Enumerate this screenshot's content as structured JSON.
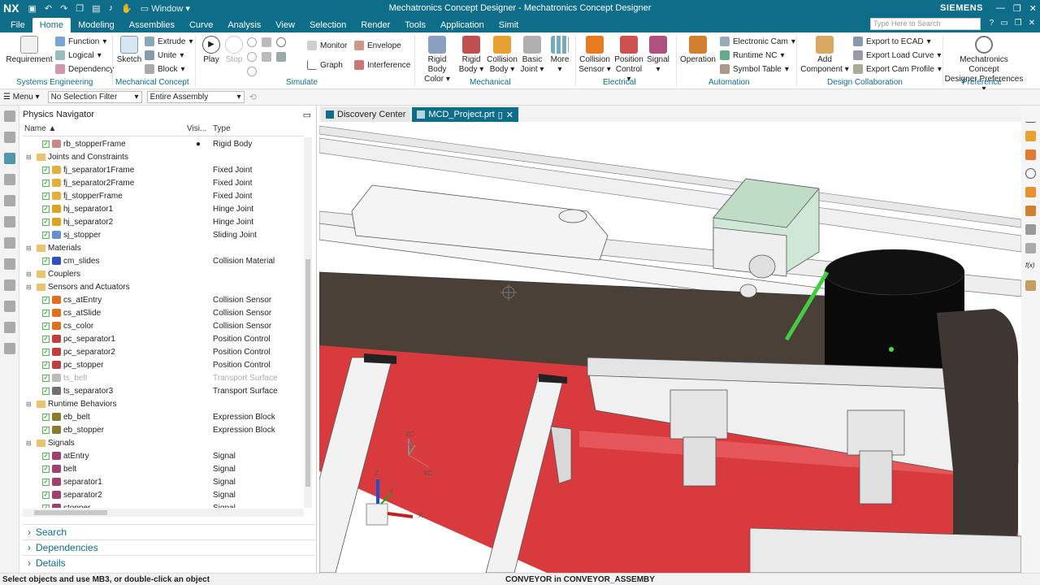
{
  "titlebar": {
    "logo": "NX",
    "window_menu": "Window",
    "title": "Mechatronics Concept Designer - Mechatronics Concept Designer",
    "brand": "SIEMENS"
  },
  "menubar": {
    "tabs": [
      "File",
      "Home",
      "Modeling",
      "Assemblies",
      "Curve",
      "Analysis",
      "View",
      "Selection",
      "Render",
      "Tools",
      "Application",
      "Simit"
    ],
    "active": "Home",
    "search_placeholder": "Type Here to Search"
  },
  "ribbon": {
    "requirement": "Requirement",
    "function": "Function",
    "logical": "Logical",
    "dependency": "Dependency",
    "sketch": "Sketch",
    "extrude": "Extrude",
    "unite": "Unite",
    "block": "Block",
    "play": "Play",
    "stop": "Stop",
    "monitor": "Monitor",
    "graph": "Graph",
    "envelope": "Envelope",
    "interference": "Interference",
    "rigid_body_color": [
      "Rigid Body",
      "Color"
    ],
    "rigid_body": [
      "Rigid",
      "Body"
    ],
    "collision_body": [
      "Collision",
      "Body"
    ],
    "basic_joint": [
      "Basic",
      "Joint"
    ],
    "more": "More",
    "collision_sensor": [
      "Collision",
      "Sensor"
    ],
    "position_control": [
      "Position",
      "Control"
    ],
    "signal": "Signal",
    "operation": "Operation",
    "electronic_cam": "Electronic Cam",
    "runtime_nc": "Runtime NC",
    "symbol_table": "Symbol Table",
    "add_component": [
      "Add",
      "Component"
    ],
    "export_ecad": "Export to ECAD",
    "export_load_curve": "Export Load Curve",
    "export_cam_profile": "Export Cam Profile",
    "mcd_preferences": [
      "Mechatronics Concept",
      "Designer Preferences"
    ],
    "groups": [
      "Systems Engineering",
      "Mechanical Concept",
      "Simulate",
      "Mechanical",
      "Electrical",
      "Automation",
      "Design Collaboration",
      "Preference"
    ]
  },
  "cmdbar": {
    "menu": "Menu",
    "filter": "No Selection Filter",
    "scope": "Entire Assembly"
  },
  "navigator": {
    "title": "Physics Navigator",
    "columns": [
      "Name",
      "Visi...",
      "Type"
    ],
    "rows": [
      {
        "name": "rb_stopperFrame",
        "type": "Rigid Body",
        "kind": "item",
        "icon": "#c88",
        "vis": "●"
      },
      {
        "name": "Joints and Constraints",
        "type": "",
        "kind": "folder"
      },
      {
        "name": "fj_separator1Frame",
        "type": "Fixed Joint",
        "kind": "item",
        "icon": "#e0b040"
      },
      {
        "name": "fj_separator2Frame",
        "type": "Fixed Joint",
        "kind": "item",
        "icon": "#e0b040"
      },
      {
        "name": "fj_stopperFrame",
        "type": "Fixed Joint",
        "kind": "item",
        "icon": "#e0b040"
      },
      {
        "name": "hj_separator1",
        "type": "Hinge Joint",
        "kind": "item",
        "icon": "#d9a520"
      },
      {
        "name": "hj_separator2",
        "type": "Hinge Joint",
        "kind": "item",
        "icon": "#d9a520"
      },
      {
        "name": "sj_stopper",
        "type": "Sliding Joint",
        "kind": "item",
        "icon": "#6a8fd0"
      },
      {
        "name": "Materials",
        "type": "",
        "kind": "folder"
      },
      {
        "name": "cm_slides",
        "type": "Collision Material",
        "kind": "item",
        "icon": "#3050c0"
      },
      {
        "name": "Couplers",
        "type": "",
        "kind": "folder"
      },
      {
        "name": "Sensors and Actuators",
        "type": "",
        "kind": "folder"
      },
      {
        "name": "cs_atEntry",
        "type": "Collision Sensor",
        "kind": "item",
        "icon": "#e07020"
      },
      {
        "name": "cs_atSlide",
        "type": "Collision Sensor",
        "kind": "item",
        "icon": "#e07020"
      },
      {
        "name": "cs_color",
        "type": "Collision Sensor",
        "kind": "item",
        "icon": "#e07020"
      },
      {
        "name": "pc_separator1",
        "type": "Position Control",
        "kind": "item",
        "icon": "#c04040"
      },
      {
        "name": "pc_separator2",
        "type": "Position Control",
        "kind": "item",
        "icon": "#c04040"
      },
      {
        "name": "pc_stopper",
        "type": "Position Control",
        "kind": "item",
        "icon": "#c04040"
      },
      {
        "name": "ts_belt",
        "type": "Transport Surface",
        "kind": "item",
        "icon": "#bbbbbb",
        "dim": true
      },
      {
        "name": "ts_separator3",
        "type": "Transport Surface",
        "kind": "item",
        "icon": "#707070"
      },
      {
        "name": "Runtime Behaviors",
        "type": "",
        "kind": "folder"
      },
      {
        "name": "eb_belt",
        "type": "Expression Block",
        "kind": "item",
        "icon": "#8a7a30"
      },
      {
        "name": "eb_stopper",
        "type": "Expression Block",
        "kind": "item",
        "icon": "#8a7a30"
      },
      {
        "name": "Signals",
        "type": "",
        "kind": "folder"
      },
      {
        "name": "atEntry",
        "type": "Signal",
        "kind": "item",
        "icon": "#a04070"
      },
      {
        "name": "belt",
        "type": "Signal",
        "kind": "item",
        "icon": "#a04070"
      },
      {
        "name": "separator1",
        "type": "Signal",
        "kind": "item",
        "icon": "#a04070"
      },
      {
        "name": "separator2",
        "type": "Signal",
        "kind": "item",
        "icon": "#a04070"
      },
      {
        "name": "stopper",
        "type": "Signal",
        "kind": "item",
        "icon": "#a04070"
      }
    ],
    "panels": [
      "Search",
      "Dependencies",
      "Details"
    ]
  },
  "tabs": {
    "discovery": "Discovery Center",
    "project": "MCD_Project.prt"
  },
  "viewport": {
    "axis_zc": "ZC",
    "axis_yc": "YC",
    "axis_xc": "XC",
    "axis_z": "Z",
    "axis_y": "Y",
    "axis_x": "X"
  },
  "status": {
    "prompt": "Select objects and use MB3, or double-click an object",
    "context": "CONVEYOR in CONVEYOR_ASSEMBY"
  }
}
